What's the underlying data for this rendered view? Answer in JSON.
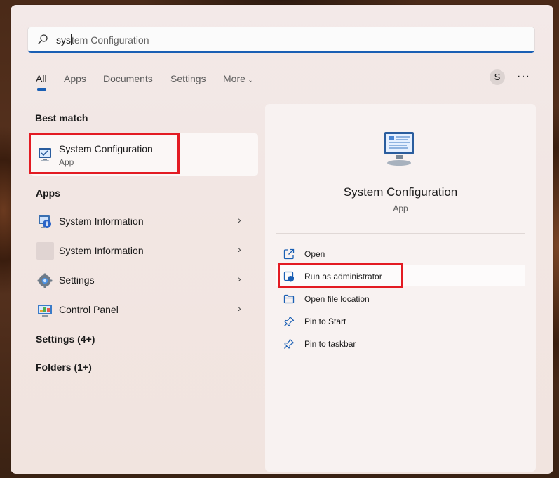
{
  "search": {
    "typed": "sys",
    "suggestion": "tem Configuration"
  },
  "tabs": [
    {
      "label": "All"
    },
    {
      "label": "Apps"
    },
    {
      "label": "Documents"
    },
    {
      "label": "Settings"
    },
    {
      "label": "More"
    }
  ],
  "account": {
    "initial": "S"
  },
  "menu_dots": "···",
  "best_match": {
    "heading": "Best match",
    "title": "System Configuration",
    "subtitle": "App",
    "icon": "system-configuration-icon"
  },
  "apps": {
    "heading": "Apps",
    "items": [
      {
        "label": "System Information",
        "icon": "system-information-icon"
      },
      {
        "label": "System Information",
        "icon": "blank-app-icon"
      },
      {
        "label": "Settings",
        "icon": "gear-icon"
      },
      {
        "label": "Control Panel",
        "icon": "control-panel-icon"
      }
    ]
  },
  "settings_group": "Settings (4+)",
  "folders_group": "Folders (1+)",
  "detail": {
    "title": "System Configuration",
    "subtitle": "App",
    "actions": [
      {
        "label": "Open",
        "icon": "open-external-icon"
      },
      {
        "label": "Run as administrator",
        "icon": "shield-icon"
      },
      {
        "label": "Open file location",
        "icon": "folder-icon"
      },
      {
        "label": "Pin to Start",
        "icon": "pin-icon"
      },
      {
        "label": "Pin to taskbar",
        "icon": "pin-icon"
      }
    ]
  },
  "colors": {
    "accent": "#1a5fb4",
    "highlight_box": "#e31b23"
  }
}
